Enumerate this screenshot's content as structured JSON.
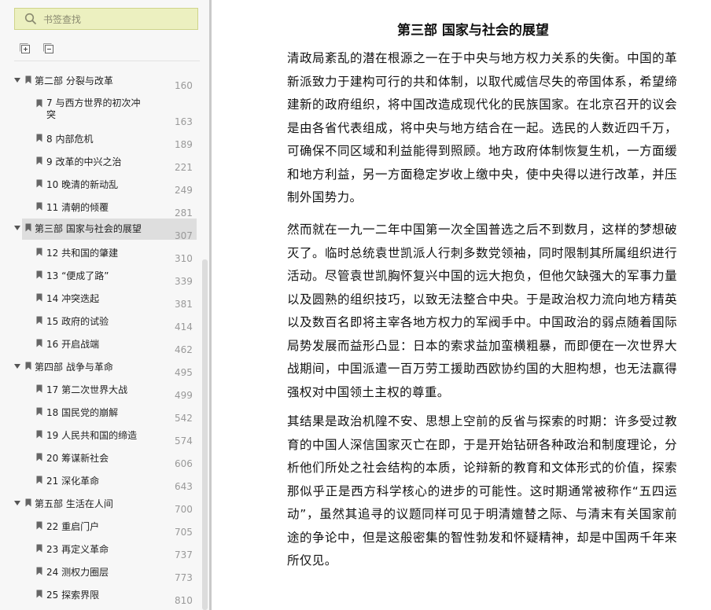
{
  "search": {
    "placeholder": "书签查找"
  },
  "toolbar": {
    "expand_icon": "expand-all-icon",
    "collapse_icon": "collapse-all-icon"
  },
  "bookmarks": [
    {
      "level": 0,
      "expanded": true,
      "label": "第二部 分裂与改革",
      "page": "160"
    },
    {
      "level": 1,
      "label": "7 与西方世界的初次冲突",
      "page": "163",
      "wrap": true
    },
    {
      "level": 1,
      "label": "8 内部危机",
      "page": "189"
    },
    {
      "level": 1,
      "label": "9 改革的中兴之治",
      "page": "221"
    },
    {
      "level": 1,
      "label": "10 晚清的新动乱",
      "page": "249"
    },
    {
      "level": 1,
      "label": "11 清朝的倾覆",
      "page": "281"
    },
    {
      "level": 0,
      "expanded": true,
      "selected": true,
      "label": "第三部 国家与社会的展望",
      "page": "307"
    },
    {
      "level": 1,
      "label": "12 共和国的肇建",
      "page": "310"
    },
    {
      "level": 1,
      "label": "13 “便成了路”",
      "page": "339"
    },
    {
      "level": 1,
      "label": "14 冲突迭起",
      "page": "381"
    },
    {
      "level": 1,
      "label": "15 政府的试验",
      "page": "414"
    },
    {
      "level": 1,
      "label": "16 开启战端",
      "page": "462"
    },
    {
      "level": 0,
      "expanded": true,
      "label": "第四部 战争与革命",
      "page": "495"
    },
    {
      "level": 1,
      "label": "17 第二次世界大战",
      "page": "499"
    },
    {
      "level": 1,
      "label": "18 国民党的崩解",
      "page": "542"
    },
    {
      "level": 1,
      "label": "19 人民共和国的缔造",
      "page": "574"
    },
    {
      "level": 1,
      "label": "20 筹谋新社会",
      "page": "606"
    },
    {
      "level": 1,
      "label": "21 深化革命",
      "page": "643"
    },
    {
      "level": 0,
      "expanded": true,
      "label": "第五部 生活在人间",
      "page": "700"
    },
    {
      "level": 1,
      "label": "22 重启门户",
      "page": "705"
    },
    {
      "level": 1,
      "label": "23 再定义革命",
      "page": "737"
    },
    {
      "level": 1,
      "label": "24 测权力圈层",
      "page": "773"
    },
    {
      "level": 1,
      "label": "25 探索界限",
      "page": "810"
    }
  ],
  "reader": {
    "title": "第三部 国家与社会的展望",
    "paragraphs": [
      "清政局紊乱的潜在根源之一在于中央与地方权力关系的失衡。中国的革新派致力于建构可行的共和体制，以取代威信尽失的帝国体系，希望缔建新的政府组织，将中国改造成现代化的民族国家。在北京召开的议会是由各省代表组成，将中央与地方结合在一起。选民的人数近四千万，可确保不同区域和利益能得到照顾。地方政府体制恢复生机，一方面缓和地方利益，另一方面稳定岁收上缴中央，使中央得以进行改革，并压制外国势力。",
      "然而就在一九一二年中国第一次全国普选之后不到数月，这样的梦想破灭了。临时总统袁世凯派人行刺多数党领袖，同时限制其所属组织进行活动。尽管袁世凯胸怀复兴中国的远大抱负，但他欠缺强大的军事力量以及圆熟的组织技巧，以致无法整合中央。于是政治权力流向地方精英以及数百名即将主宰各地方权力的军阀手中。中国政治的弱点随着国际局势发展而益形凸显：日本的索求益加蛮横粗暴，而即便在一次世界大战期间，中国派遣一百万劳工援助西欧协约国的大胆构想，也无法赢得强权对中国领土主权的尊重。",
      "其结果是政治机隍不安、思想上空前的反省与探索的时期：许多受过教育的中国人深信国家灭亡在即，于是开始钻研各种政治和制度理论，分析他们所处之社会结构的本质，论辩新的教育和文体形式的价值，探索那似乎正是西方科学核心的进步的可能性。这时期通常被称作“五四运动”，虽然其追寻的议题同样可见于明清嬗替之际、与清末有关国家前途的争论中，但是这般密集的智性勃发和怀疑精神，却是中国两千年来所仅见。"
    ]
  }
}
